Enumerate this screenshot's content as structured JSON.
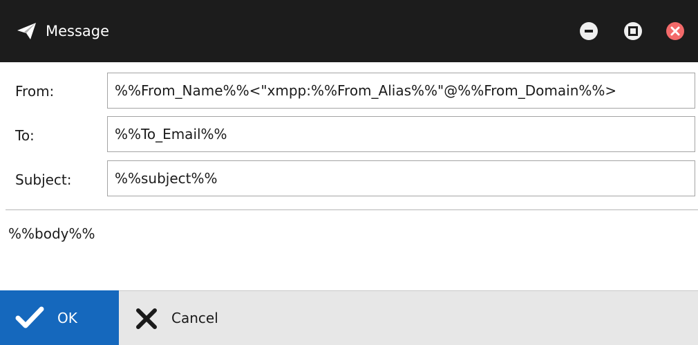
{
  "window": {
    "title": "Message",
    "icons": {
      "app": "paper-plane-icon",
      "minimize": "minimize-icon",
      "maximize": "maximize-icon",
      "close": "close-icon"
    },
    "colors": {
      "titlebar": "#1c1c1c",
      "close_button": "#f36a6a",
      "ok_button": "#1568bd",
      "footer": "#e7e7e7"
    }
  },
  "form": {
    "from_label": "From:",
    "from_value": "%%From_Name%%<\"xmpp:%%From_Alias%%\"@%%From_Domain%%>",
    "to_label": "To:",
    "to_value": "%%To_Email%%",
    "subject_label": "Subject:",
    "subject_value": "%%subject%%"
  },
  "body": {
    "text": "%%body%%"
  },
  "footer": {
    "ok_label": "OK",
    "ok_icon": "checkmark-icon",
    "cancel_label": "Cancel",
    "cancel_icon": "x-icon"
  }
}
